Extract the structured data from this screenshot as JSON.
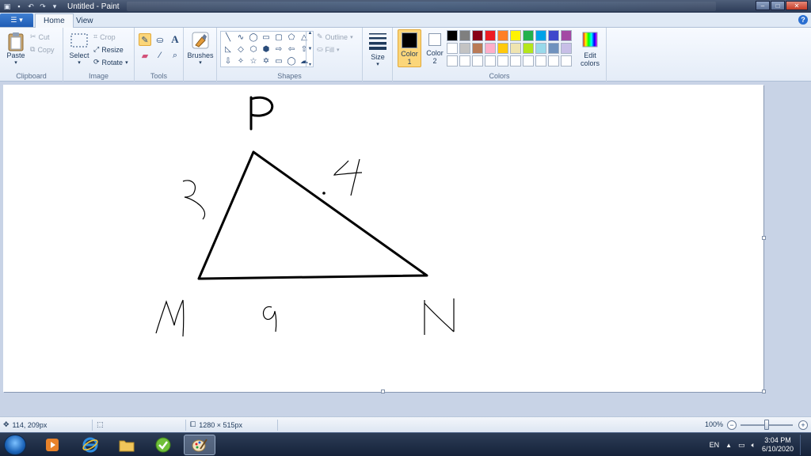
{
  "window": {
    "title": "Untitled - Paint",
    "controls": {
      "minimize": "–",
      "maximize": "□",
      "close": "✕"
    }
  },
  "tabs": {
    "home": "Home",
    "view": "View",
    "help": "?"
  },
  "ribbon": {
    "clipboard": {
      "label": "Clipboard",
      "paste": "Paste",
      "cut": "Cut",
      "copy": "Copy"
    },
    "image": {
      "label": "Image",
      "select": "Select",
      "crop": "Crop",
      "resize": "Resize",
      "rotate": "Rotate"
    },
    "tools": {
      "label": "Tools",
      "text_glyph": "A"
    },
    "brushes": {
      "label": "Brushes"
    },
    "shapes": {
      "label": "Shapes",
      "outline": "Outline",
      "fill": "Fill"
    },
    "size": {
      "label": "Size"
    },
    "colors": {
      "label": "Colors",
      "color1": "Color\n1",
      "color1_line1": "Color",
      "color1_line2": "1",
      "color2_line1": "Color",
      "color2_line2": "2",
      "edit_line1": "Edit",
      "edit_line2": "colors",
      "color1_value": "#000000",
      "color2_value": "#ffffff",
      "palette_row1": [
        "#000000",
        "#7f7f7f",
        "#880015",
        "#ed1c24",
        "#ff7f27",
        "#fff200",
        "#22b14c",
        "#00a2e8",
        "#3f48cc",
        "#a349a4"
      ],
      "palette_row2": [
        "#ffffff",
        "#c3c3c3",
        "#b97a57",
        "#ffaec9",
        "#ffc90e",
        "#efe4b0",
        "#b5e61d",
        "#99d9ea",
        "#7092be",
        "#c8bfe7"
      ],
      "palette_row3": [
        "#ffffff",
        "#ffffff",
        "#ffffff",
        "#ffffff",
        "#ffffff",
        "#ffffff",
        "#ffffff",
        "#ffffff",
        "#ffffff",
        "#ffffff"
      ]
    }
  },
  "statusbar": {
    "cursor_position": "114, 209px",
    "canvas_size": "1280 × 515px",
    "zoom": "100%"
  },
  "taskbar": {
    "language": "EN",
    "time": "3:04 PM",
    "date": "6/10/2020"
  },
  "icons": {
    "paste": "clipboard-icon",
    "cut": "scissors-icon",
    "copy": "copy-icon",
    "select": "select-icon",
    "crop": "crop-icon",
    "resize": "resize-icon",
    "rotate": "rotate-icon",
    "pencil": "pencil-icon",
    "fill": "fill-bucket-icon",
    "text": "text-icon",
    "eraser": "eraser-icon",
    "picker": "color-picker-icon",
    "magnifier": "magnifier-icon"
  }
}
